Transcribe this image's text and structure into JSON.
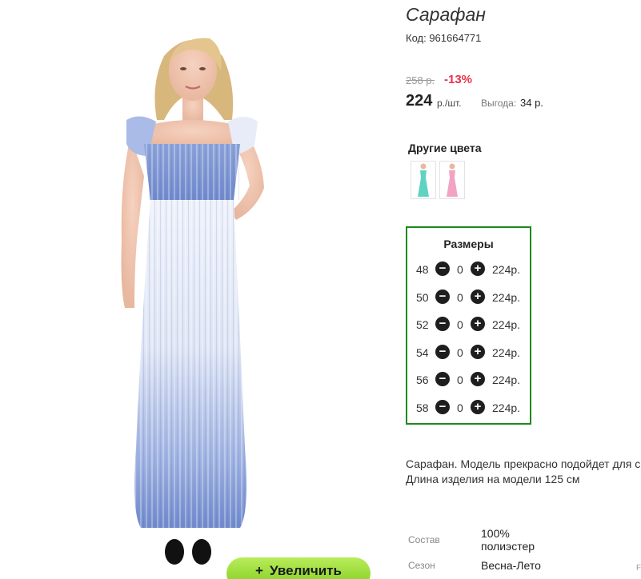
{
  "product": {
    "title": "Сарафан",
    "code": "Код: 961664771",
    "old_price": "258 р.",
    "discount": "-13%",
    "price": "224",
    "price_unit": "р./шт.",
    "benefit_label": "Выгода:",
    "benefit_value": "34 р."
  },
  "other_colors": {
    "heading": "Другие цвета",
    "swatches": [
      {
        "name": "turquoise",
        "color": "#5fd3c3"
      },
      {
        "name": "pink",
        "color": "#f2a3c4"
      }
    ]
  },
  "sizes": {
    "heading": "Размеры",
    "rows": [
      {
        "size": "48",
        "qty": "0",
        "price": "224р."
      },
      {
        "size": "50",
        "qty": "0",
        "price": "224р."
      },
      {
        "size": "52",
        "qty": "0",
        "price": "224р."
      },
      {
        "size": "54",
        "qty": "0",
        "price": "224р."
      },
      {
        "size": "56",
        "qty": "0",
        "price": "224р."
      },
      {
        "size": "58",
        "qty": "0",
        "price": "224р."
      }
    ]
  },
  "description": {
    "line1": "Сарафан. Модель прекрасно подойдет для с",
    "line2": "Длина изделия на модели 125 см"
  },
  "specs": [
    {
      "label": "Состав",
      "value": "100% полиэстер"
    },
    {
      "label": "Сезон",
      "value": "Весна-Лето"
    }
  ],
  "zoom_button": {
    "plus": "+",
    "label": "Увеличить"
  },
  "edge_text": "F",
  "colors": {
    "accent_green": "#1c8a1c",
    "discount_red": "#e8334a",
    "zoom_green": "#8fd82e",
    "dress_blue": "#6f89cc"
  }
}
